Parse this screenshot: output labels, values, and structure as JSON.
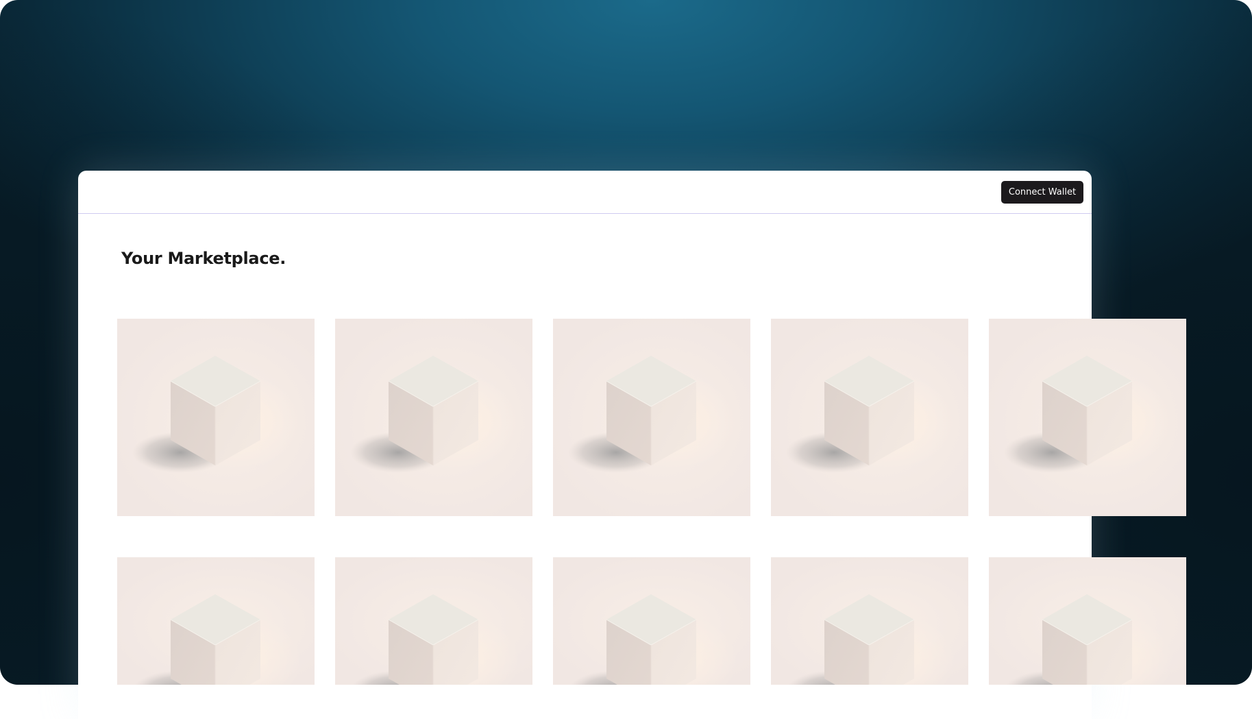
{
  "header": {
    "connect_wallet_label": "Connect Wallet"
  },
  "main": {
    "title": "Your Marketplace."
  },
  "grid": {
    "rows": 2,
    "columns": 5,
    "items": [
      {
        "image": "cube-image"
      },
      {
        "image": "cube-image"
      },
      {
        "image": "cube-image"
      },
      {
        "image": "cube-image"
      },
      {
        "image": "cube-image"
      },
      {
        "image": "cube-image"
      },
      {
        "image": "cube-image"
      },
      {
        "image": "cube-image"
      },
      {
        "image": "cube-image"
      },
      {
        "image": "cube-image"
      }
    ]
  },
  "colors": {
    "button_bg": "#1c1a1d",
    "divider": "#cfcaf0",
    "tile_bg": "#f3e9e5",
    "background_accent": "#145673"
  }
}
